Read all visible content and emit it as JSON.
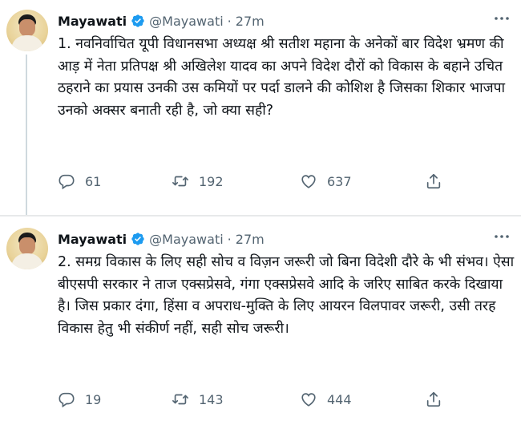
{
  "tweets": [
    {
      "author_name": "Mayawati",
      "handle": "@Mayawati",
      "separator": "·",
      "time": "27m",
      "text": "1. नवनिर्वाचित यूपी विधानसभा अध्यक्ष श्री सतीश महाना के अनेकों बार विदेश भ्रमण की आड़ में नेता प्रतिपक्ष श्री अखिलेश यादव का अपने विदेश दौरों को विकास के बहाने उचित ठहराने का प्रयास उनकी उस कमियों पर पर्दा डालने की कोशिश है जिसका शिकार भाजपा उनको अक्सर बनाती रही है, जो क्या सही?",
      "replies": "61",
      "retweets": "192",
      "likes": "637"
    },
    {
      "author_name": "Mayawati",
      "handle": "@Mayawati",
      "separator": "·",
      "time": "27m",
      "text": "2. समग्र विकास के लिए सही सोच व विज़न जरूरी जो बिना विदेशी दौरे के भी संभव। ऐसा बीएसपी सरकार ने ताज एक्सप्रेसवे, गंगा एक्सप्रेसवे आदि के जरिए साबित करके दिखाया है। जिस प्रकार दंगा, हिंसा व अपराध-मुक्ति के लिए आयरन विलपावर जरूरी, उसी तरह विकास हेतु भी संकीर्ण नहीं, सही सोच जरूरी।",
      "replies": "19",
      "retweets": "143",
      "likes": "444"
    }
  ],
  "colors": {
    "text": "#0f1419",
    "secondary": "#536471",
    "verified": "#1d9bf0",
    "divider": "#e7e9ea"
  },
  "icons": [
    "verified-badge-icon",
    "more-icon",
    "reply-icon",
    "retweet-icon",
    "like-icon",
    "share-icon"
  ]
}
